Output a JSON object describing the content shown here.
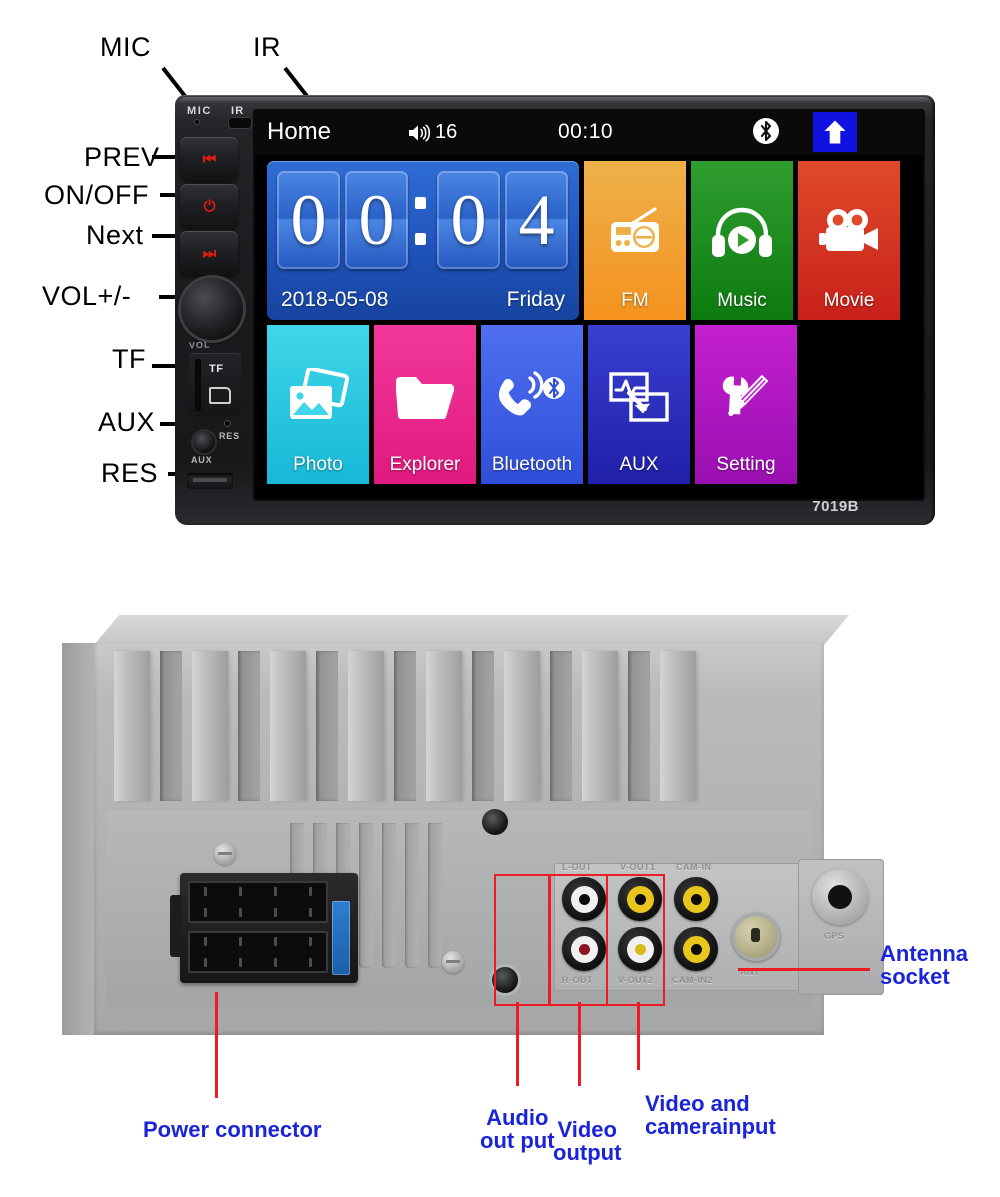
{
  "front_unit": {
    "model_label": "7019B",
    "top_markings": {
      "mic": "MIC",
      "ir": "IR"
    },
    "side_markings": {
      "vol": "VOL",
      "tf": "TF",
      "aux": "AUX",
      "res": "RES"
    },
    "callouts": [
      {
        "id": "mic",
        "label": "MIC"
      },
      {
        "id": "ir",
        "label": "IR"
      },
      {
        "id": "prev",
        "label": "PREV"
      },
      {
        "id": "onoff",
        "label": "ON/OFF"
      },
      {
        "id": "next",
        "label": "Next"
      },
      {
        "id": "vol",
        "label": "VOL+/-"
      },
      {
        "id": "tf",
        "label": "TF"
      },
      {
        "id": "aux",
        "label": "AUX"
      },
      {
        "id": "res",
        "label": "RES"
      }
    ],
    "keys": [
      {
        "name": "prev-key",
        "glyph": "⏮"
      },
      {
        "name": "power-key",
        "glyph": "⏻"
      },
      {
        "name": "next-key",
        "glyph": "⏭"
      }
    ]
  },
  "screen": {
    "status_bar": {
      "title": "Home",
      "volume_value": "16",
      "clock": "00:10",
      "bluetooth_icon": "bluetooth-icon",
      "home_button_icon": "home-arrow-icon"
    },
    "clock_widget": {
      "hour_digit_1": "0",
      "hour_digit_2": "0",
      "minute_digit_1": "0",
      "minute_digit_2": "4",
      "date": "2018-05-08",
      "weekday": "Friday"
    },
    "tiles": [
      {
        "label": "FM",
        "icon": "radio-icon",
        "color_start": "#edb14a",
        "color_end": "#f5921e"
      },
      {
        "label": "Music",
        "icon": "headphone-icon",
        "color_start": "#2f9e2f",
        "color_end": "#0d7a10"
      },
      {
        "label": "Movie",
        "icon": "camcorder-icon",
        "color_start": "#e04a2a",
        "color_end": "#c8201a"
      },
      {
        "label": "Photo",
        "icon": "picture-icon",
        "color_start": "#3fd6e8",
        "color_end": "#17b8d8"
      },
      {
        "label": "Explorer",
        "icon": "folder-icon",
        "color_start": "#f2389a",
        "color_end": "#e0197f"
      },
      {
        "label": "Bluetooth",
        "icon": "phone-bt-icon",
        "color_start": "#4f6ff0",
        "color_end": "#2f4fd8"
      },
      {
        "label": "AUX",
        "icon": "aux-signal-icon",
        "color_start": "#3a3fd0",
        "color_end": "#2020a8"
      },
      {
        "label": "Setting",
        "icon": "tools-icon",
        "color_start": "#c41fd0",
        "color_end": "#9a0fb0"
      }
    ]
  },
  "rear_unit": {
    "engraved_labels": {
      "l_out": "L-OUT",
      "r_out": "R-OUT",
      "v_out1": "V-OUT1",
      "v_out2": "V-OUT2",
      "cam_in1": "CAM-IN",
      "cam_in2": "CAM-IN2",
      "ant": "ANT",
      "gps": "GPS"
    },
    "callouts": [
      {
        "id": "power",
        "label": "Power connector"
      },
      {
        "id": "audio",
        "label_line1": "Audio",
        "label_line2": "out put"
      },
      {
        "id": "video",
        "label_line1": "Video",
        "label_line2": "output"
      },
      {
        "id": "camera",
        "label_line1": "Video and",
        "label_line2": "camerainput"
      },
      {
        "id": "antenna",
        "label_line1": "Antenna",
        "label_line2": "socket"
      }
    ]
  },
  "colors": {
    "annotation_black": "#000000",
    "annotation_blue": "#1a24d8",
    "callout_red": "#ed1c24",
    "home_button_blue": "#1212e0",
    "key_glyph_red": "#e01b12"
  }
}
